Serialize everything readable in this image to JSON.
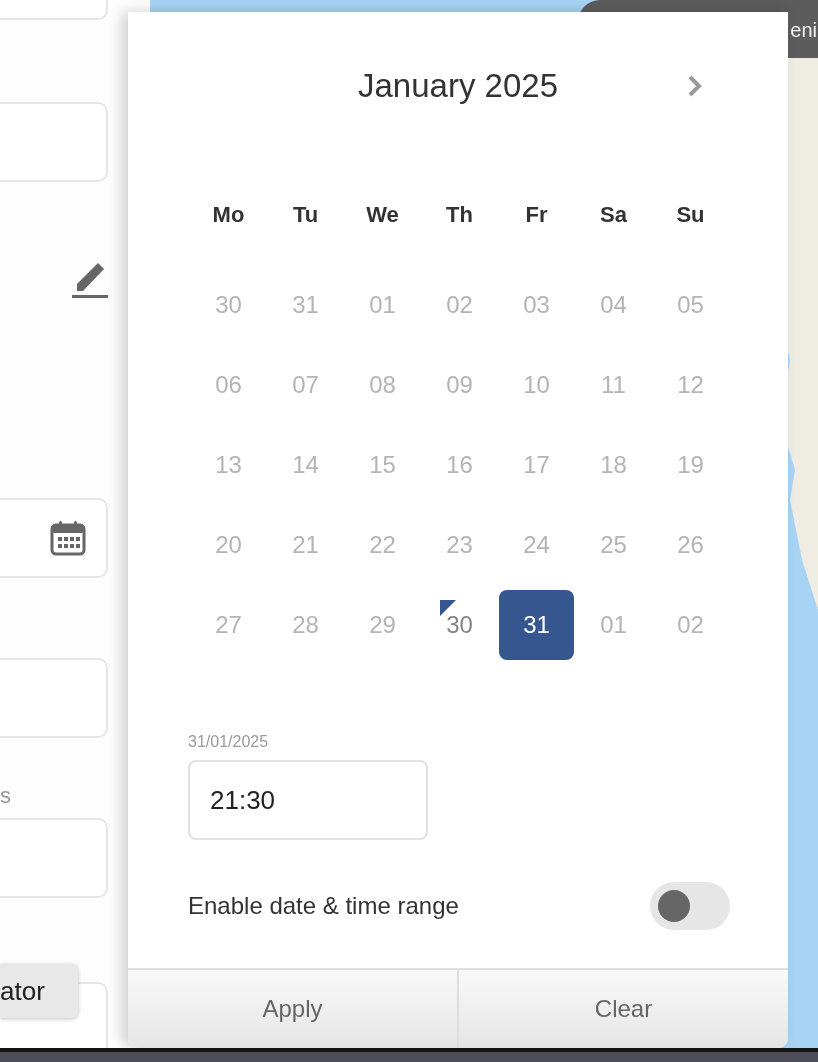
{
  "side_panel": {
    "field_label": "s",
    "tooltip": "ator"
  },
  "map": {
    "banner": "eni"
  },
  "date_picker": {
    "month_title": "January 2025",
    "weekdays": [
      "Mo",
      "Tu",
      "We",
      "Th",
      "Fr",
      "Sa",
      "Su"
    ],
    "weeks": [
      [
        {
          "day": "30",
          "disabled": true,
          "selected": false,
          "today": false
        },
        {
          "day": "31",
          "disabled": true,
          "selected": false,
          "today": false
        },
        {
          "day": "01",
          "disabled": true,
          "selected": false,
          "today": false
        },
        {
          "day": "02",
          "disabled": true,
          "selected": false,
          "today": false
        },
        {
          "day": "03",
          "disabled": true,
          "selected": false,
          "today": false
        },
        {
          "day": "04",
          "disabled": true,
          "selected": false,
          "today": false
        },
        {
          "day": "05",
          "disabled": true,
          "selected": false,
          "today": false
        }
      ],
      [
        {
          "day": "06",
          "disabled": true,
          "selected": false,
          "today": false
        },
        {
          "day": "07",
          "disabled": true,
          "selected": false,
          "today": false
        },
        {
          "day": "08",
          "disabled": true,
          "selected": false,
          "today": false
        },
        {
          "day": "09",
          "disabled": true,
          "selected": false,
          "today": false
        },
        {
          "day": "10",
          "disabled": true,
          "selected": false,
          "today": false
        },
        {
          "day": "11",
          "disabled": true,
          "selected": false,
          "today": false
        },
        {
          "day": "12",
          "disabled": true,
          "selected": false,
          "today": false
        }
      ],
      [
        {
          "day": "13",
          "disabled": true,
          "selected": false,
          "today": false
        },
        {
          "day": "14",
          "disabled": true,
          "selected": false,
          "today": false
        },
        {
          "day": "15",
          "disabled": true,
          "selected": false,
          "today": false
        },
        {
          "day": "16",
          "disabled": true,
          "selected": false,
          "today": false
        },
        {
          "day": "17",
          "disabled": true,
          "selected": false,
          "today": false
        },
        {
          "day": "18",
          "disabled": true,
          "selected": false,
          "today": false
        },
        {
          "day": "19",
          "disabled": true,
          "selected": false,
          "today": false
        }
      ],
      [
        {
          "day": "20",
          "disabled": true,
          "selected": false,
          "today": false
        },
        {
          "day": "21",
          "disabled": true,
          "selected": false,
          "today": false
        },
        {
          "day": "22",
          "disabled": true,
          "selected": false,
          "today": false
        },
        {
          "day": "23",
          "disabled": true,
          "selected": false,
          "today": false
        },
        {
          "day": "24",
          "disabled": true,
          "selected": false,
          "today": false
        },
        {
          "day": "25",
          "disabled": true,
          "selected": false,
          "today": false
        },
        {
          "day": "26",
          "disabled": true,
          "selected": false,
          "today": false
        }
      ],
      [
        {
          "day": "27",
          "disabled": true,
          "selected": false,
          "today": false
        },
        {
          "day": "28",
          "disabled": true,
          "selected": false,
          "today": false
        },
        {
          "day": "29",
          "disabled": true,
          "selected": false,
          "today": false
        },
        {
          "day": "30",
          "disabled": false,
          "selected": false,
          "today": true
        },
        {
          "day": "31",
          "disabled": false,
          "selected": true,
          "today": false
        },
        {
          "day": "01",
          "disabled": true,
          "selected": false,
          "today": false
        },
        {
          "day": "02",
          "disabled": true,
          "selected": false,
          "today": false
        }
      ]
    ],
    "date_label": "31/01/2025",
    "time": {
      "value": "21:30"
    },
    "range_toggle": {
      "label": "Enable date & time range",
      "on": false
    },
    "buttons": [
      "Apply",
      "Clear"
    ]
  }
}
